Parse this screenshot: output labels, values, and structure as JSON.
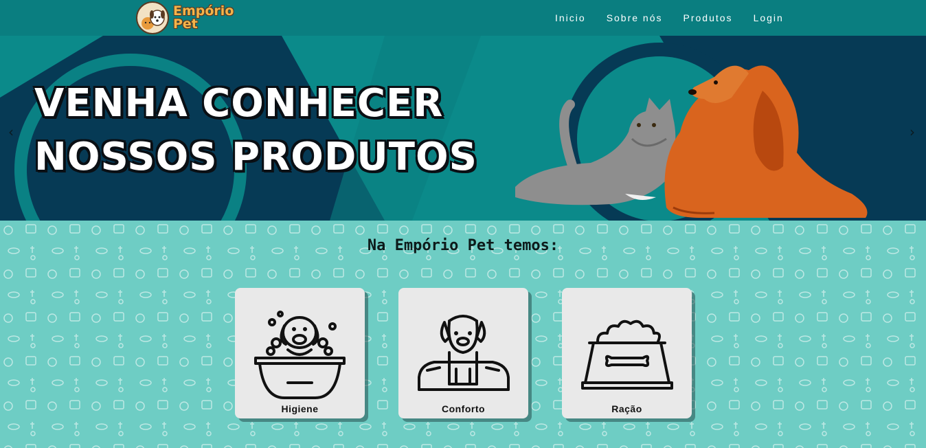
{
  "brand": {
    "line1": "Empório",
    "line2": "Pet"
  },
  "nav": [
    {
      "label": "Inicio"
    },
    {
      "label": "Sobre nós"
    },
    {
      "label": "Produtos"
    },
    {
      "label": "Login"
    }
  ],
  "banner": {
    "line1": "VENHA CONHECER",
    "line2": "NOSSOS PRODUTOS",
    "prev": "‹",
    "next": "›"
  },
  "section": {
    "title": "Na Empório Pet temos:"
  },
  "cards": [
    {
      "label": "Higiene",
      "icon": "dog-bath-icon"
    },
    {
      "label": "Conforto",
      "icon": "dog-bed-icon"
    },
    {
      "label": "Ração",
      "icon": "food-bowl-icon"
    }
  ],
  "colors": {
    "navbar": "#0a7e80",
    "banner": "#0b8a8a",
    "banner_dark": "#063a55",
    "page_bg": "#6ecdc4",
    "card_bg": "#e9e9e9"
  }
}
